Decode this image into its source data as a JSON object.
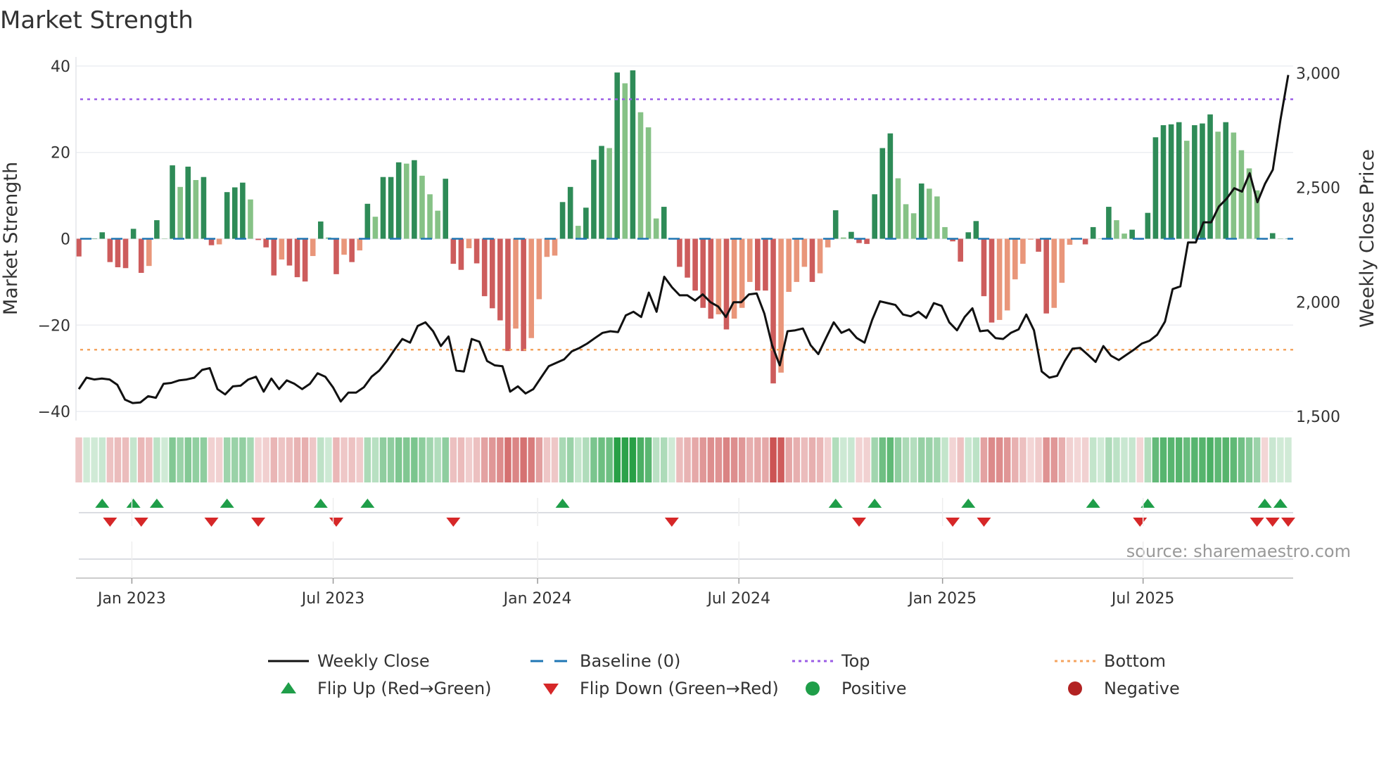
{
  "chart_data": {
    "type": "bar",
    "title": "Market Strength",
    "ylabel": "Market Strength",
    "y2label": "Weekly Close Price",
    "ylim": [
      -42,
      42
    ],
    "y2lim": [
      1500,
      3000
    ],
    "yticks": [
      40,
      20,
      0,
      -20,
      -40
    ],
    "ytick_labels": [
      "40",
      "20",
      "0",
      "−20",
      "−40"
    ],
    "y2ticks": [
      3000,
      2500,
      2000,
      1500
    ],
    "y2tick_labels": [
      "3,000",
      "2,500",
      "2,000",
      "1,500"
    ],
    "x_unit": "week index",
    "x_ticks": [
      {
        "label": "Jan 2023",
        "week": 6.8
      },
      {
        "label": "Jul 2023",
        "week": 32.6
      },
      {
        "label": "Jan 2024",
        "week": 58.8
      },
      {
        "label": "Jul 2024",
        "week": 84.6
      },
      {
        "label": "Jan 2025",
        "week": 110.7
      },
      {
        "label": "Jul 2025",
        "week": 136.4
      }
    ],
    "grid": true,
    "top_level": 32.3,
    "bottom_level": -25.7,
    "baseline": 0,
    "strength": [
      -4.1,
      0,
      0,
      1.5,
      -5.4,
      -6.6,
      -6.8,
      2.3,
      -7.9,
      -6.3,
      4.3,
      0,
      17,
      12,
      16.7,
      13.6,
      14.3,
      -1.5,
      -1.3,
      10.8,
      11.9,
      13,
      9.1,
      -0.3,
      -2,
      -8.5,
      -4.8,
      -6.2,
      -8.9,
      -9.9,
      -4,
      4,
      0.3,
      -8.2,
      -3.7,
      -5.4,
      -2.7,
      8.1,
      5.1,
      14.3,
      14.3,
      17.7,
      17.4,
      18.2,
      14.6,
      10.3,
      6.5,
      13.9,
      -5.8,
      -7.2,
      -2.2,
      -5.7,
      -13.3,
      -16.1,
      -18.9,
      -26,
      -20.8,
      -26,
      -23,
      -14,
      -4.2,
      -3.9,
      8.5,
      12,
      3,
      7.2,
      18.3,
      21.5,
      21,
      38.5,
      36,
      39,
      29.3,
      25.8,
      4.7,
      7.4,
      0,
      -6.5,
      -9,
      -12,
      -16,
      -18.5,
      -17.5,
      -21,
      -18.5,
      -16,
      -10,
      -12,
      -12,
      -33.5,
      -31,
      -12.3,
      -10,
      -6.5,
      -10,
      -8,
      -2,
      6.6,
      0.3,
      1.6,
      -1,
      -1.2,
      10.3,
      21,
      24.4,
      14,
      8,
      5.9,
      12.8,
      11.6,
      9.8,
      2.7,
      -0.6,
      -5.3,
      1.5,
      4.1,
      -13.3,
      -19.4,
      -18.8,
      -16.6,
      -9.4,
      -5.8,
      -0.2,
      -3,
      -17.3,
      -16,
      -10.2,
      -1.4,
      -0.1,
      -1.3,
      2.7,
      0,
      7.4,
      4.3,
      1.2,
      2.1,
      -0.2,
      6,
      23.5,
      26.3,
      26.5,
      27,
      22.7,
      26.3,
      26.7,
      28.8,
      24.8,
      27,
      24.6,
      20.5,
      16.3,
      11.2,
      -0.2,
      1.3,
      0,
      0
    ],
    "weekly_close": [
      1619,
      1669,
      1661,
      1665,
      1661,
      1638,
      1573,
      1558,
      1561,
      1588,
      1581,
      1642,
      1646,
      1657,
      1661,
      1669,
      1703,
      1711,
      1619,
      1596,
      1631,
      1634,
      1661,
      1673,
      1608,
      1665,
      1619,
      1657,
      1642,
      1619,
      1642,
      1688,
      1673,
      1627,
      1565,
      1604,
      1604,
      1627,
      1673,
      1700,
      1742,
      1792,
      1838,
      1822,
      1895,
      1911,
      1872,
      1807,
      1849,
      1700,
      1696,
      1838,
      1826,
      1742,
      1723,
      1719,
      1608,
      1631,
      1600,
      1619,
      1669,
      1719,
      1734,
      1749,
      1784,
      1799,
      1818,
      1842,
      1865,
      1872,
      1868,
      1941,
      1957,
      1934,
      2041,
      1957,
      2110,
      2064,
      2029,
      2029,
      2006,
      2033,
      1999,
      1980,
      1934,
      1999,
      1999,
      2033,
      2037,
      1949,
      1811,
      1723,
      1872,
      1876,
      1884,
      1811,
      1772,
      1842,
      1911,
      1865,
      1880,
      1842,
      1822,
      1922,
      2003,
      1995,
      1987,
      1945,
      1937,
      1957,
      1930,
      1995,
      1983,
      1911,
      1876,
      1934,
      1972,
      1872,
      1876,
      1842,
      1838,
      1865,
      1880,
      1945,
      1876,
      1696,
      1669,
      1677,
      1742,
      1796,
      1799,
      1769,
      1738,
      1807,
      1765,
      1746,
      1769,
      1792,
      1818,
      1830,
      1857,
      1914,
      2056,
      2068,
      2260,
      2260,
      2348,
      2348,
      2417,
      2451,
      2497,
      2482,
      2563,
      2436,
      2517,
      2578,
      2797,
      2992
    ],
    "flip_up_weeks": [
      3,
      7,
      10,
      19,
      31,
      37,
      62,
      97,
      102,
      114,
      130,
      137,
      152,
      154
    ],
    "flip_down_weeks": [
      4,
      8,
      17,
      23,
      33,
      48,
      76,
      100,
      112,
      116,
      136,
      151,
      153,
      155
    ],
    "legend": {
      "placement": "bottom",
      "items": [
        {
          "label": "Weekly Close",
          "kind": "line-solid",
          "color": "#111111"
        },
        {
          "label": "Baseline (0)",
          "kind": "line-dashed",
          "color": "#1f77b4"
        },
        {
          "label": "Top",
          "kind": "line-dotted",
          "color": "#9b5de5"
        },
        {
          "label": "Bottom",
          "kind": "line-dotted",
          "color": "#f4a460"
        },
        {
          "label": "Flip Up (Red→Green)",
          "kind": "triangle-up",
          "color": "#1f9e49"
        },
        {
          "label": "Flip Down (Green→Red)",
          "kind": "triangle-down",
          "color": "#d62728"
        },
        {
          "label": "Positive",
          "kind": "circle",
          "color": "#1f9e49"
        },
        {
          "label": "Negative",
          "kind": "circle",
          "color": "#b22222"
        }
      ]
    },
    "colors": {
      "pos_rising": "#2e8b57",
      "pos_falling": "#86c286",
      "neg_falling": "#cd5c5c",
      "neg_rising": "#e9967a",
      "top": "#9b5de5",
      "bottom": "#f4a460",
      "baseline": "#1f77b4",
      "close": "#111111",
      "grid": "#eceef2"
    },
    "source": "source: sharemaestro.com"
  }
}
